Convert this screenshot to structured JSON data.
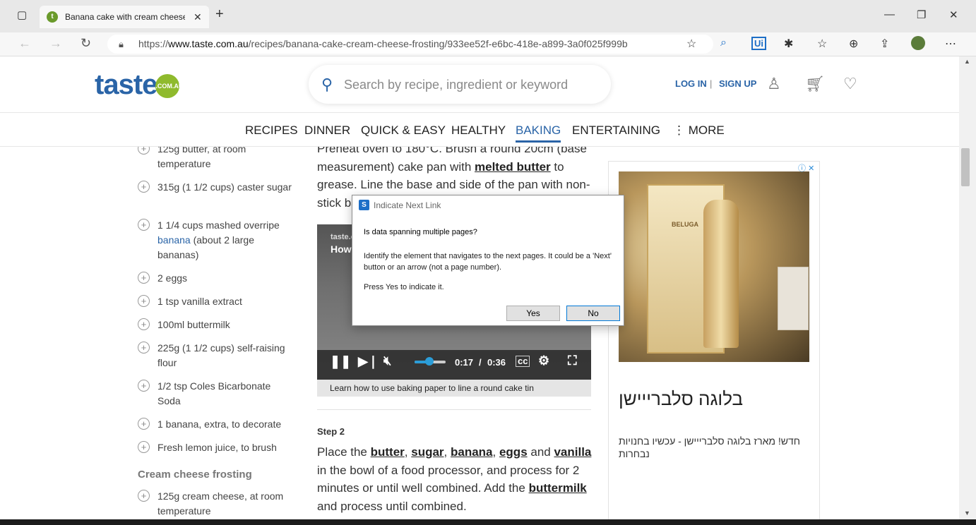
{
  "browser": {
    "tab_title": "Banana cake with cream cheese f",
    "tab_favicon": "t",
    "url_prefix": "https://",
    "url_domain": "www.taste.com.au",
    "url_path": "/recipes/banana-cake-cream-cheese-frosting/933ee52f-e6bc-418e-a899-3a0f025f999b"
  },
  "header": {
    "logo_text": "taste",
    "logo_badge": ".COM.AU",
    "search_placeholder": "Search by recipe, ingredient or keyword",
    "login": "LOG IN",
    "separator": "|",
    "signup": "SIGN UP"
  },
  "menu": {
    "items": [
      "RECIPES",
      "DINNER",
      "QUICK & EASY",
      "HEALTHY",
      "BAKING",
      "ENTERTAINING",
      "MORE"
    ],
    "active": "BAKING"
  },
  "ingredients": {
    "items": [
      {
        "text": "125g butter, at room temperature"
      },
      {
        "text": "315g (1 1/2 cups) caster sugar"
      },
      {
        "pre": "1 1/4 cups mashed overripe ",
        "link": "banana",
        "post": " (about 2 large bananas)"
      },
      {
        "text": "2 eggs"
      },
      {
        "text": "1 tsp vanilla extract"
      },
      {
        "text": "100ml buttermilk"
      },
      {
        "text": "225g (1 1/2 cups) self-raising flour"
      },
      {
        "text": "1/2 tsp Coles Bicarbonate Soda"
      },
      {
        "text": "1 banana, extra, to decorate"
      },
      {
        "text": "Fresh lemon juice, to brush"
      }
    ],
    "frosting_title": "Cream cheese frosting",
    "frosting_items": [
      {
        "text": "125g cream cheese, at room temperature"
      }
    ]
  },
  "method": {
    "step1_a": "Preheat oven to 180°C. Brush a round 20cm (base measurement) cake pan with ",
    "step1_link": "melted butter",
    "step1_b": " to grease. Line the base and side of the pan with non-stick ba",
    "video": {
      "brand": "taste.c",
      "heading": "How",
      "current_time": "0:17",
      "time_sep": "/",
      "duration": "0:36",
      "progress": 0.47,
      "caption": "Learn how to use baking paper to line a round cake tin"
    },
    "step2_title": "Step 2",
    "step2": {
      "t1": "Place the ",
      "l1": "butter",
      "t2": ", ",
      "l2": "sugar",
      "t3": ", ",
      "l3": "banana",
      "t4": ", ",
      "l4": "eggs",
      "t5": " and ",
      "l5": "vanilla",
      "t6": " in the bowl of a food processor, and process for 2 minutes or until well combined. Add the ",
      "l6": "buttermilk",
      "t7": " and process until combined."
    }
  },
  "ad": {
    "brand": "BELUGA",
    "title": "בלוגה סלברייישן",
    "description": "חדש! מארז בלוגה סלברייישן - עכשיו בחנויות נבחרות",
    "badge_info": "ⓘ",
    "badge_close": "✕"
  },
  "dialog": {
    "title": "Indicate Next Link",
    "question": "Is data spanning multiple pages?",
    "body": "Identify the element that navigates to the next pages. It could be a 'Next' button or an arrow (not a page number).",
    "instruction": "Press Yes to indicate it.",
    "yes": "Yes",
    "no": "No"
  }
}
